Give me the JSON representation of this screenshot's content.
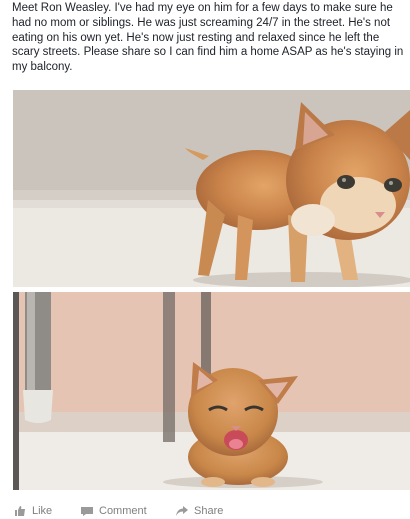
{
  "post": {
    "text": "Meet Ron Weasley. I've had my eye on him for a few days to make sure he had no mom or siblings. He was just screaming 24/7 in the street. He's not eating on his own yet. He's now just resting and relaxed since he left the scary streets. Please share so I can find him a home ASAP as he's staying in my balcony."
  },
  "actions": {
    "like_label": "Like",
    "comment_label": "Comment",
    "share_label": "Share"
  },
  "icons": {
    "like": "thumbs-up-icon",
    "comment": "comment-icon",
    "share": "share-arrow-icon"
  }
}
